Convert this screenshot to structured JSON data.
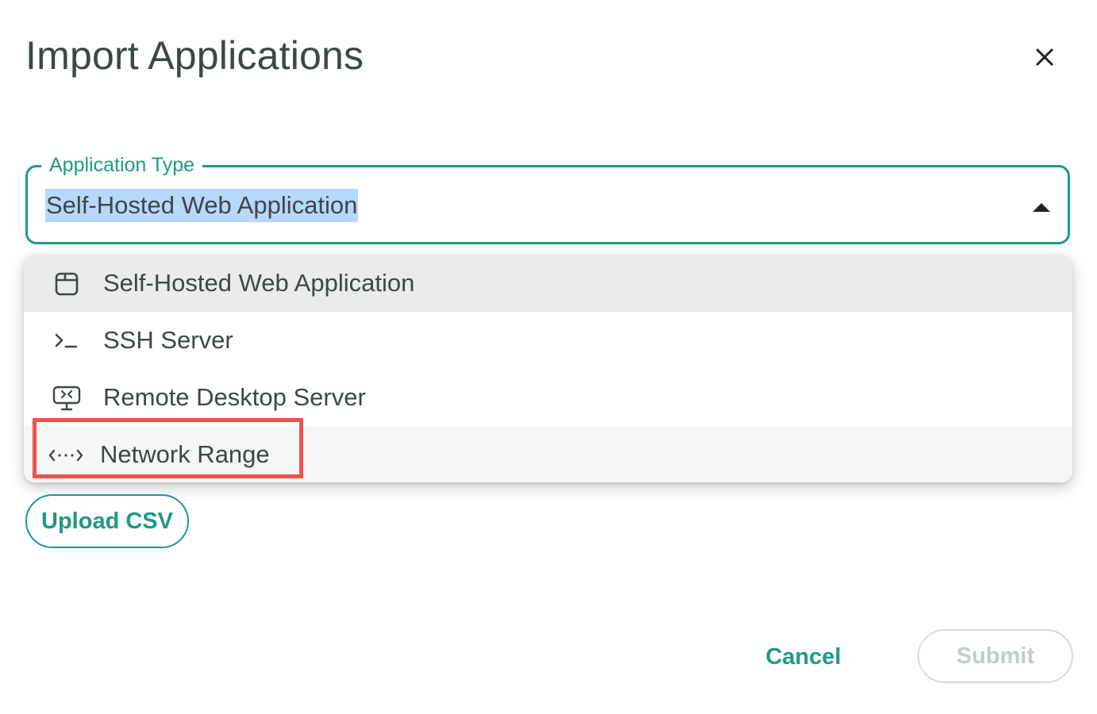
{
  "dialog": {
    "title": "Import Applications",
    "close_icon": "close-icon"
  },
  "application_type": {
    "label": "Application Type",
    "value": "Self-Hosted Web Application",
    "dropdown_open": true
  },
  "menu": {
    "items": [
      {
        "label": "Self-Hosted Web Application",
        "icon": "browser-window-icon",
        "selected": true
      },
      {
        "label": "SSH Server",
        "icon": "terminal-icon",
        "selected": false
      },
      {
        "label": "Remote Desktop Server",
        "icon": "remote-desktop-icon",
        "selected": false
      },
      {
        "label": "Network Range",
        "icon": "network-range-icon",
        "selected": false,
        "highlighted": true
      }
    ]
  },
  "actions": {
    "upload_label": "Upload CSV",
    "cancel_label": "Cancel",
    "submit_label": "Submit",
    "submit_disabled": true
  },
  "colors": {
    "accent": "#1f9987",
    "title_text": "#3d4747",
    "selection_highlight": "#b7d7fb",
    "annotation_red": "#f5504c",
    "disabled_text": "#c4cccb"
  }
}
